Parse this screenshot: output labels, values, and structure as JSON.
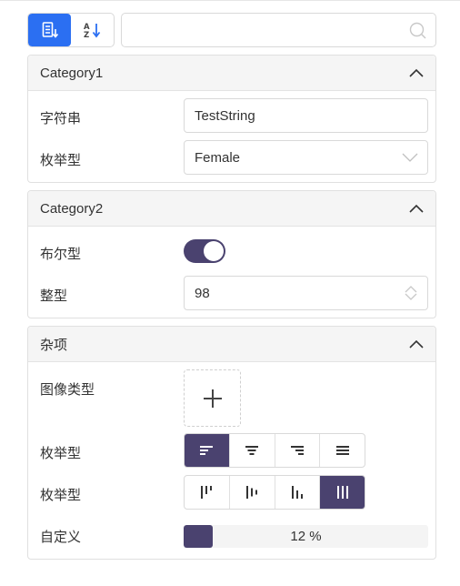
{
  "toolbar": {
    "buttons": [
      {
        "icon": "categorized-view-icon",
        "active": true
      },
      {
        "icon": "sort-az-icon",
        "active": false
      }
    ],
    "search": {
      "value": "",
      "placeholder": "",
      "icon": "search-icon"
    }
  },
  "categories": [
    {
      "title": "Category1",
      "expanded": true,
      "properties": [
        {
          "label": "字符串",
          "type": "text",
          "value": "TestString"
        },
        {
          "label": "枚举型",
          "type": "select",
          "value": "Female"
        }
      ]
    },
    {
      "title": "Category2",
      "expanded": true,
      "properties": [
        {
          "label": "布尔型",
          "type": "toggle",
          "value": true
        },
        {
          "label": "整型",
          "type": "number",
          "value": "98"
        }
      ]
    },
    {
      "title": "杂项",
      "expanded": true,
      "properties": [
        {
          "label": "图像类型",
          "type": "image",
          "icon": "plus-icon"
        },
        {
          "label": "枚举型",
          "type": "text-align",
          "options": [
            "align-left-icon",
            "align-center-icon",
            "align-right-icon",
            "align-justify-icon"
          ],
          "selected_index": 0
        },
        {
          "label": "枚举型",
          "type": "vertical-align",
          "options": [
            "align-top-icon",
            "align-middle-icon",
            "align-bottom-icon",
            "align-stretch-icon"
          ],
          "selected_index": 3
        },
        {
          "label": "自定义",
          "type": "progress",
          "value": 0.12,
          "text": "12 %"
        }
      ]
    }
  ],
  "colors": {
    "accent": "#2b6ff2",
    "selected": "#4a426f"
  }
}
